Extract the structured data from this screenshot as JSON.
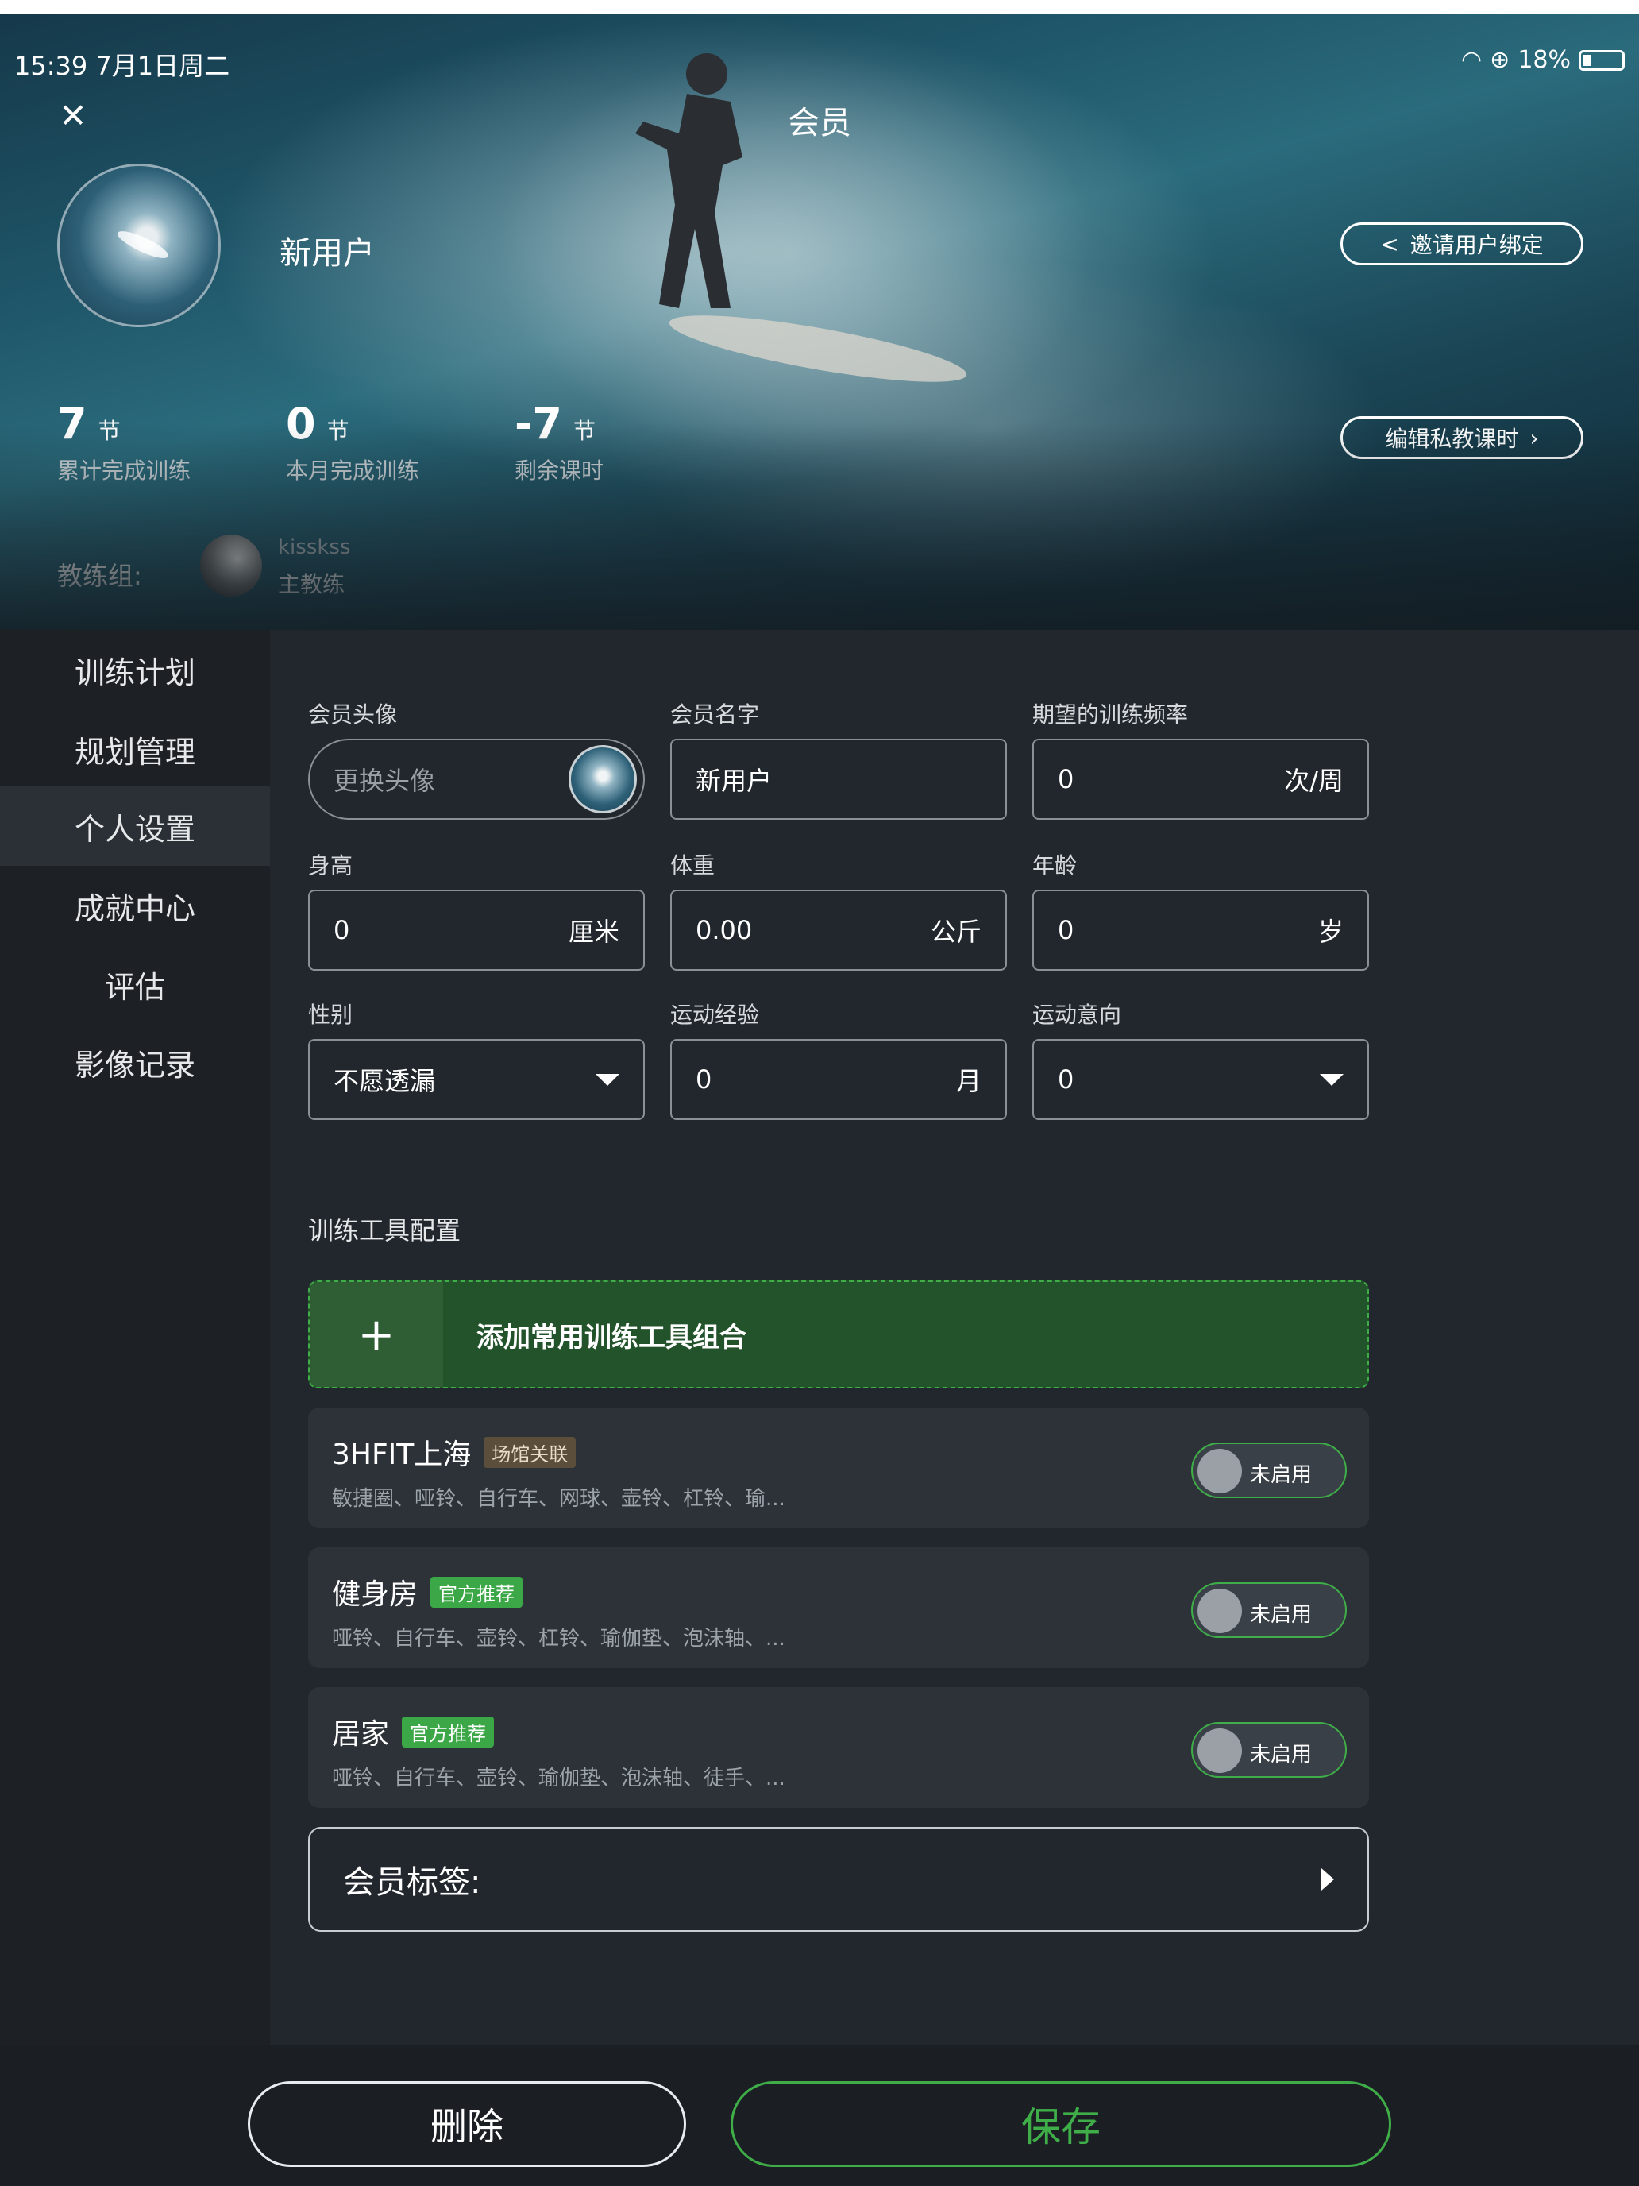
{
  "status_bar": {
    "time": "15:39",
    "date": "7月1日周二",
    "battery": "18%"
  },
  "header": {
    "title": "会员"
  },
  "profile": {
    "name": "新用户",
    "invite_label": "邀请用户绑定",
    "edit_label": "编辑私教课时",
    "stats": [
      {
        "value": "7",
        "unit": "节",
        "label": "累计完成训练"
      },
      {
        "value": "0",
        "unit": "节",
        "label": "本月完成训练"
      },
      {
        "value": "-7",
        "unit": "节",
        "label": "剩余课时"
      }
    ],
    "coach_group_label": "教练组:",
    "coach": {
      "name": "kisskss",
      "role": "主教练"
    }
  },
  "sidebar": {
    "items": [
      {
        "label": "训练计划"
      },
      {
        "label": "规划管理"
      },
      {
        "label": "个人设置",
        "active": true
      },
      {
        "label": "成就中心"
      },
      {
        "label": "评估"
      },
      {
        "label": "影像记录"
      }
    ]
  },
  "form": {
    "avatar": {
      "label": "会员头像",
      "placeholder": "更换头像"
    },
    "name": {
      "label": "会员名字",
      "value": "新用户"
    },
    "frequency": {
      "label": "期望的训练频率",
      "value": "0",
      "unit": "次/周"
    },
    "height": {
      "label": "身高",
      "value": "0",
      "unit": "厘米"
    },
    "weight": {
      "label": "体重",
      "value": "0.00",
      "unit": "公斤"
    },
    "age": {
      "label": "年龄",
      "value": "0",
      "unit": "岁"
    },
    "gender": {
      "label": "性别",
      "value": "不愿透漏"
    },
    "experience": {
      "label": "运动经验",
      "value": "0",
      "unit": "月"
    },
    "intention": {
      "label": "运动意向",
      "value": "0"
    }
  },
  "tools": {
    "section_title": "训练工具配置",
    "add_label": "添加常用训练工具组合",
    "cards": [
      {
        "title": "3HFIT上海",
        "badge": "场馆关联",
        "desc": "敏捷圈、哑铃、自行车、网球、壶铃、杠铃、瑜...",
        "toggle": "未启用"
      },
      {
        "title": "健身房",
        "badge": "官方推荐",
        "desc": "哑铃、自行车、壶铃、杠铃、瑜伽垫、泡沫轴、...",
        "toggle": "未启用"
      },
      {
        "title": "居家",
        "badge": "官方推荐",
        "desc": "哑铃、自行车、壶铃、瑜伽垫、泡沫轴、徒手、...",
        "toggle": "未启用"
      }
    ]
  },
  "tags": {
    "label": "会员标签:"
  },
  "footer": {
    "delete_label": "删除",
    "save_label": "保存"
  }
}
